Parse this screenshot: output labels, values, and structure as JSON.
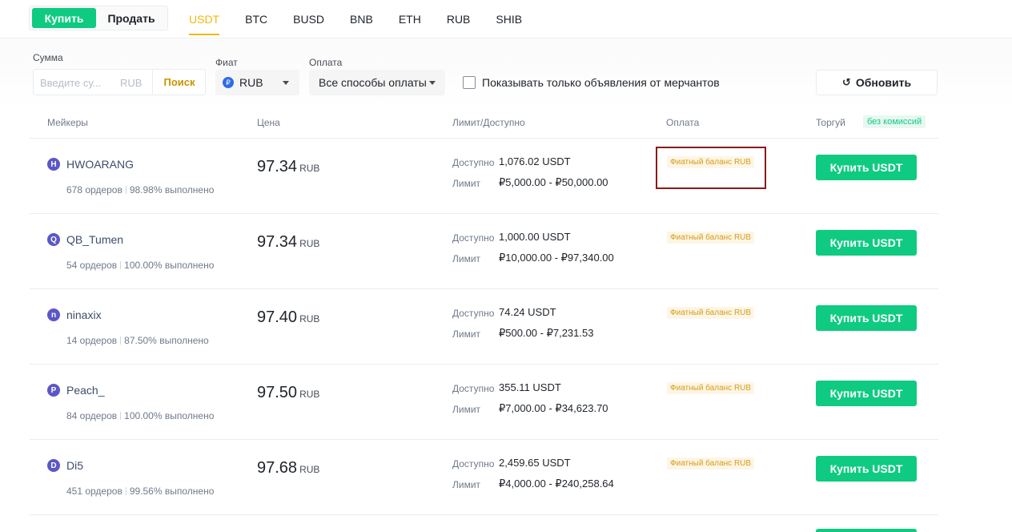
{
  "trade_toggle": {
    "buy": "Купить",
    "sell": "Продать"
  },
  "assets": [
    "USDT",
    "BTC",
    "BUSD",
    "BNB",
    "ETH",
    "RUB",
    "SHIB"
  ],
  "active_asset": "USDT",
  "filters": {
    "amount_label": "Сумма",
    "amount_placeholder": "Введите су...",
    "amount_currency": "RUB",
    "search_button": "Поиск",
    "fiat_label": "Фиат",
    "fiat_value": "RUB",
    "fiat_icon": "₽",
    "payment_label": "Оплата",
    "payment_value": "Все способы оплаты",
    "merchant_only_label": "Показывать только объявления от мерчантов",
    "refresh_button": "Обновить"
  },
  "table_header": {
    "makers": "Мейкеры",
    "price": "Цена",
    "limit_available": "Лимит/Доступно",
    "payment": "Оплата",
    "trade": "Торгуй",
    "no_fee_badge": "без комиссий"
  },
  "labels": {
    "available": "Доступно",
    "limit": "Лимит"
  },
  "colors": {
    "buy_green": "#0ecb81",
    "accent_yellow": "#f0b90b",
    "payment_tag": "#d89b16",
    "highlight_box": "#8b1a1a"
  },
  "rows": [
    {
      "initial": "H",
      "name": "HWOARANG",
      "orders": "678 ордеров",
      "completion": "98.98% выполнено",
      "price": "97.34",
      "price_unit": "RUB",
      "available": "1,076.02 USDT",
      "limit": "₽5,000.00 - ₽50,000.00",
      "payment_tag": "Фиатный баланс RUB",
      "button": "Купить USDT"
    },
    {
      "initial": "Q",
      "name": "QB_Tumen",
      "orders": "54 ордеров",
      "completion": "100.00% выполнено",
      "price": "97.34",
      "price_unit": "RUB",
      "available": "1,000.00 USDT",
      "limit": "₽10,000.00 - ₽97,340.00",
      "payment_tag": "Фиатный баланс RUB",
      "button": "Купить USDT"
    },
    {
      "initial": "n",
      "name": "ninaxix",
      "orders": "14 ордеров",
      "completion": "87.50% выполнено",
      "price": "97.40",
      "price_unit": "RUB",
      "available": "74.24 USDT",
      "limit": "₽500.00 - ₽7,231.53",
      "payment_tag": "Фиатный баланс RUB",
      "button": "Купить USDT"
    },
    {
      "initial": "P",
      "name": "Peach_",
      "orders": "84 ордеров",
      "completion": "100.00% выполнено",
      "price": "97.50",
      "price_unit": "RUB",
      "available": "355.11 USDT",
      "limit": "₽7,000.00 - ₽34,623.70",
      "payment_tag": "Фиатный баланс RUB",
      "button": "Купить USDT"
    },
    {
      "initial": "D",
      "name": "Di5",
      "orders": "451 ордеров",
      "completion": "99.56% выполнено",
      "price": "97.68",
      "price_unit": "RUB",
      "available": "2,459.65 USDT",
      "limit": "₽4,000.00 - ₽240,258.64",
      "payment_tag": "Фиатный баланс RUB",
      "button": "Купить USDT"
    }
  ]
}
